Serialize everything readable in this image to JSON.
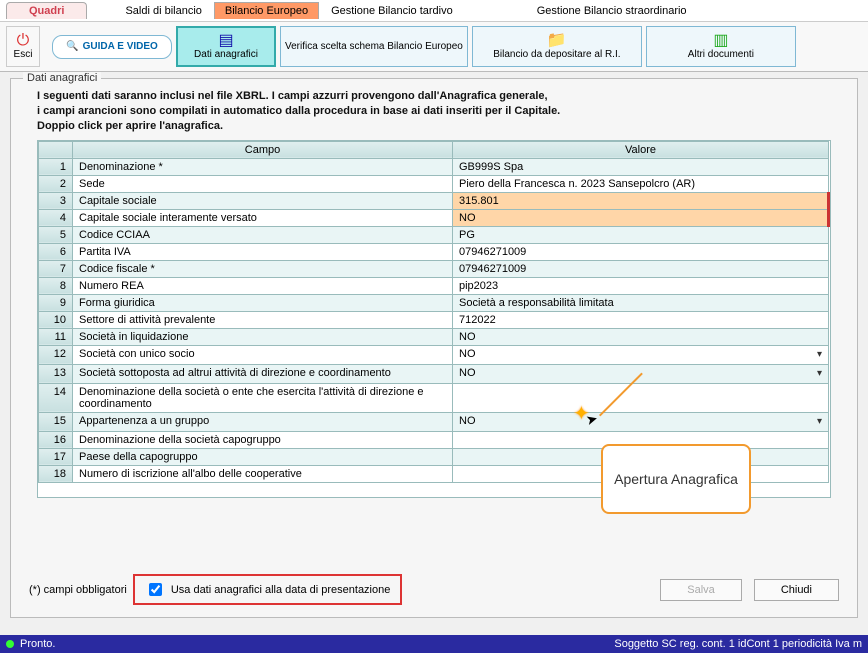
{
  "top_tabs": {
    "quadri": "Quadri",
    "items": [
      "Saldi di bilancio",
      "Bilancio Europeo",
      "Gestione Bilancio tardivo",
      "Gestione Bilancio straordinario"
    ],
    "active_index": 1
  },
  "toolbar": {
    "esci_label": "Esci",
    "guide_label": "GUIDA E VIDEO",
    "dati_anagrafici": "Dati anagrafici",
    "verifica": "Verifica scelta schema Bilancio Europeo",
    "deposito": "Bilancio da depositare al R.I.",
    "altri": "Altri documenti"
  },
  "panel_title": "Dati anagrafici",
  "intro_line1": "I seguenti dati saranno inclusi nel file XBRL. I campi azzurri provengono dall'Anagrafica generale,",
  "intro_line2": "i campi arancioni sono compilati in automatico dalla procedura in base ai dati inseriti per il Capitale.",
  "intro_line3": "Doppio click per aprire l'anagrafica.",
  "grid": {
    "headers": {
      "campo": "Campo",
      "valore": "Valore"
    },
    "rows": [
      {
        "n": 1,
        "campo": "Denominazione *",
        "valore": "GB999S Spa",
        "white": false
      },
      {
        "n": 2,
        "campo": "Sede",
        "valore": "Piero della Francesca n. 2023 Sansepolcro (AR)",
        "white": true
      },
      {
        "n": 3,
        "campo": "Capitale sociale",
        "valore": "315.801",
        "white": false,
        "orange": true
      },
      {
        "n": 4,
        "campo": "Capitale sociale interamente versato",
        "valore": "NO",
        "white": true,
        "orange": true
      },
      {
        "n": 5,
        "campo": "Codice CCIAA",
        "valore": "PG",
        "white": false
      },
      {
        "n": 6,
        "campo": "Partita IVA",
        "valore": "07946271009",
        "white": true
      },
      {
        "n": 7,
        "campo": "Codice fiscale *",
        "valore": "07946271009",
        "white": false
      },
      {
        "n": 8,
        "campo": "Numero REA",
        "valore": "pip2023",
        "white": true
      },
      {
        "n": 9,
        "campo": "Forma giuridica",
        "valore": "Società a responsabilità limitata",
        "white": false
      },
      {
        "n": 10,
        "campo": "Settore di attività prevalente",
        "valore": "712022",
        "white": true
      },
      {
        "n": 11,
        "campo": "Società in liquidazione",
        "valore": "NO",
        "white": false
      },
      {
        "n": 12,
        "campo": "Società con unico socio",
        "valore": "NO",
        "white": true,
        "dropdown": true
      },
      {
        "n": 13,
        "campo": "Società sottoposta ad altrui attività di direzione e coordinamento",
        "valore": "NO",
        "white": false,
        "dropdown": true
      },
      {
        "n": 14,
        "campo": "Denominazione della società o ente che esercita l'attività di direzione e coordinamento",
        "valore": "",
        "white": true
      },
      {
        "n": 15,
        "campo": "Appartenenza a un gruppo",
        "valore": "NO",
        "white": false,
        "dropdown": true
      },
      {
        "n": 16,
        "campo": "Denominazione della società capogruppo",
        "valore": "",
        "white": true
      },
      {
        "n": 17,
        "campo": "Paese della capogruppo",
        "valore": "",
        "white": false
      },
      {
        "n": 18,
        "campo": "Numero di iscrizione all'albo delle cooperative",
        "valore": "",
        "white": true
      }
    ]
  },
  "callout_text": "Apertura Anagrafica",
  "obbligatori_label": "(*) campi obbligatori",
  "checkbox_label": "Usa dati anagrafici alla data di presentazione",
  "checkbox_checked": true,
  "save_label": "Salva",
  "close_label": "Chiudi",
  "status_left": "Pronto.",
  "status_right": "Soggetto SC reg. cont. 1 idCont 1 periodicità Iva m"
}
